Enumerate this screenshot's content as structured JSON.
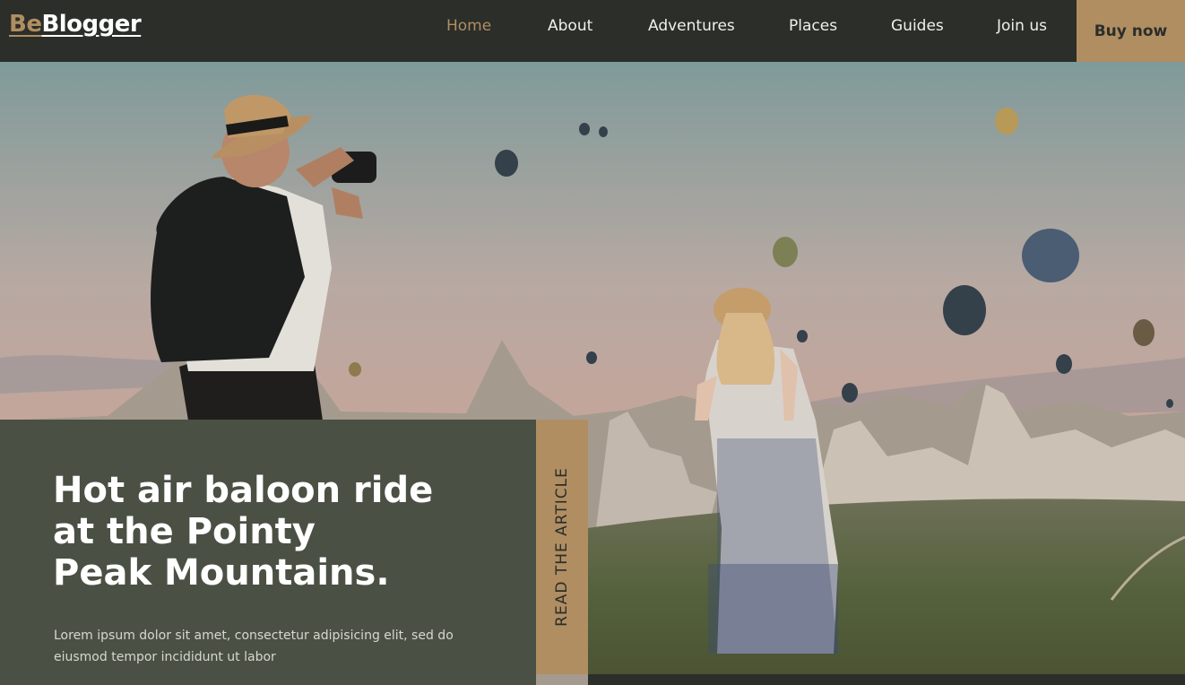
{
  "brand": {
    "part1": "Be",
    "part2": "Blogger"
  },
  "nav": {
    "items": [
      {
        "label": "Home",
        "active": true
      },
      {
        "label": "About",
        "active": false
      },
      {
        "label": "Adventures",
        "active": false
      },
      {
        "label": "Places",
        "active": false
      },
      {
        "label": "Guides",
        "active": false
      },
      {
        "label": "Join us",
        "active": false
      }
    ],
    "cta": "Buy now"
  },
  "hero": {
    "headline_lines": [
      "Hot air baloon ride",
      "at the Pointy",
      "Peak Mountains."
    ],
    "description": "Lorem ipsum dolor sit amet, consectetur adipisicing elit, sed do eiusmod tempor incididunt ut labor",
    "read_label": "READ THE ARTICLE"
  },
  "colors": {
    "accent": "#b08e62",
    "navbar": "#2b2e29",
    "card": "#4a5044"
  }
}
